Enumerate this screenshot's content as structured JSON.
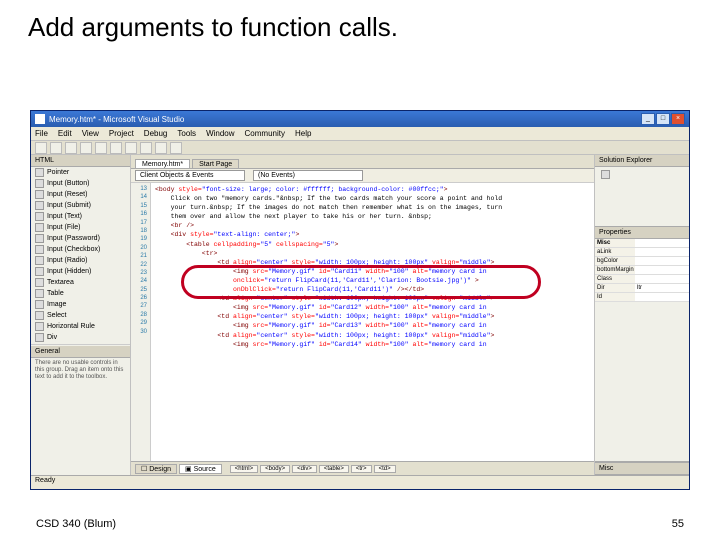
{
  "slide": {
    "title": "Add arguments to function calls.",
    "footer_left": "CSD 340 (Blum)",
    "footer_right": "55"
  },
  "window": {
    "title": "Memory.htm* - Microsoft Visual Studio",
    "buttons": {
      "min": "_",
      "max": "□",
      "close": "×"
    }
  },
  "menus": [
    "File",
    "Edit",
    "View",
    "Project",
    "Debug",
    "Tools",
    "Window",
    "Community",
    "Help"
  ],
  "doc_tabs": {
    "active": "Memory.htm*",
    "other": "Start Page"
  },
  "subbar": {
    "left": "Client Objects & Events",
    "right": "(No Events)"
  },
  "left_panel": {
    "header": "HTML",
    "items": [
      "Pointer",
      "Input (Button)",
      "Input (Reset)",
      "Input (Submit)",
      "Input (Text)",
      "Input (File)",
      "Input (Password)",
      "Input (Checkbox)",
      "Input (Radio)",
      "Input (Hidden)",
      "Textarea",
      "Table",
      "Image",
      "Select",
      "Horizontal Rule",
      "Div"
    ],
    "general": "General",
    "note": "There are no usable controls in this group. Drag an item onto this text to add it to the toolbox."
  },
  "gutter": [
    "13",
    "14",
    "15",
    "16",
    "17",
    "18",
    "19",
    "20",
    "21",
    "22",
    "23",
    "24",
    "25",
    "26",
    "27",
    "28",
    "29",
    "30"
  ],
  "code": {
    "l1a": "<body ",
    "l1b": "style=",
    "l1c": "\"font-size: large; color: #ffffff; background-color: #00ffcc;\"",
    "l1d": ">",
    "l2": "    Click on two \"memory cards.\"&nbsp; If the two cards match your score a point and hold",
    "l3": "    your turn.&nbsp; If the images do not match then remember what is on the images, turn",
    "l4": "    them over and allow the next player to take his or her turn. &nbsp;",
    "l5a": "    <br ",
    "l5b": "/>",
    "l6a": "    <div ",
    "l6b": "style=",
    "l6c": "\"text-align: center;\"",
    "l6d": ">",
    "l7a": "        <table ",
    "l7b": "cellpadding=",
    "l7c": "\"5\" ",
    "l7d": "cellspacing=",
    "l7e": "\"5\"",
    "l7f": ">",
    "l8a": "            <tr",
    "l8b": ">",
    "l9a": "                <td ",
    "l9b": "align=",
    "l9c": "\"center\" ",
    "l9d": "style=",
    "l9e": "\"width: 100px; height: 100px\" ",
    "l9f": "valign=",
    "l9g": "\"middle\"",
    "l9h": ">",
    "l10a": "                    <img ",
    "l10b": "src=",
    "l10c": "\"Memory.gif\" ",
    "l10d": "id=",
    "l10e": "\"Card11\" ",
    "l10f": "width=",
    "l10g": "\"100\" ",
    "l10h": "alt=",
    "l10i": "\"memory card in",
    "l11a": "                    onclick=",
    "l11b": "\"return FlipCard(11,'Card11','Clarion: Bootsie.jpg')\" ",
    "l11c": ">",
    "l12a": "                    onDblClick=",
    "l12b": "\"return FlipCard(11,'Card11')\" ",
    "l12c": "/></td>",
    "l13a": "                <td ",
    "l13b": "align=",
    "l13c": "\"center\" ",
    "l13d": "style=",
    "l13e": "\"width: 100px; height: 100px\" ",
    "l13f": "valign=",
    "l13g": "\"middle\"",
    "l13h": ">",
    "l14a": "                    <img ",
    "l14b": "src=",
    "l14c": "\"Memory.gif\" ",
    "l14d": "id=",
    "l14e": "\"Card12\" ",
    "l14f": "width=",
    "l14g": "\"100\" ",
    "l14h": "alt=",
    "l14i": "\"memory card in",
    "l15a": "                <td ",
    "l15b": "align=",
    "l15c": "\"center\" ",
    "l15d": "style=",
    "l15e": "\"width: 100px; height: 100px\" ",
    "l15f": "valign=",
    "l15g": "\"middle\"",
    "l15h": ">",
    "l16a": "                    <img ",
    "l16b": "src=",
    "l16c": "\"Memory.gif\" ",
    "l16d": "id=",
    "l16e": "\"Card13\" ",
    "l16f": "width=",
    "l16g": "\"100\" ",
    "l16h": "alt=",
    "l16i": "\"memory card in",
    "l17a": "                <td ",
    "l17b": "align=",
    "l17c": "\"center\" ",
    "l17d": "style=",
    "l17e": "\"width: 100px; height: 100px\" ",
    "l17f": "valign=",
    "l17g": "\"middle\"",
    "l17h": ">",
    "l18a": "                    <img ",
    "l18b": "src=",
    "l18c": "\"Memory.gif\" ",
    "l18d": "id=",
    "l18e": "\"Card14\" ",
    "l18f": "width=",
    "l18g": "\"100\" ",
    "l18h": "alt=",
    "l18i": "\"memory card in"
  },
  "view_tabs": {
    "design": "Design",
    "source": "Source"
  },
  "crumbs": [
    "<html>",
    "<body>",
    "<div>",
    "<table>",
    "<tr>",
    "<td>"
  ],
  "right": {
    "top_header": "Solution Explorer",
    "mid_header": "Properties",
    "prop_section": "Misc",
    "props": [
      {
        "k": "aLink",
        "v": ""
      },
      {
        "k": "bgColor",
        "v": ""
      },
      {
        "k": "bottomMargin",
        "v": ""
      },
      {
        "k": "Class",
        "v": ""
      },
      {
        "k": "Dir",
        "v": "ltr"
      },
      {
        "k": "Id",
        "v": ""
      }
    ],
    "desc": "Misc"
  },
  "status": "Ready"
}
